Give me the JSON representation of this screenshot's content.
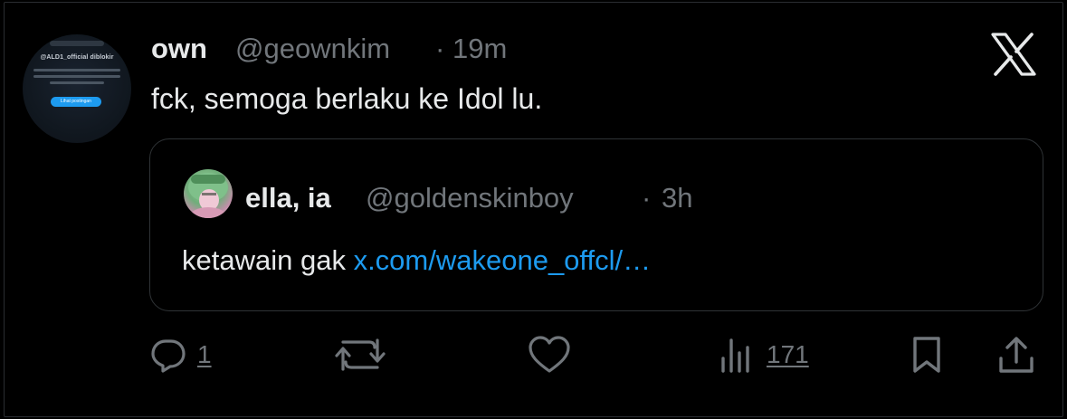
{
  "post": {
    "author_name": "own",
    "author_handle": "@geownkim",
    "separator": "·",
    "time": "19m",
    "text": "fck, semoga berlaku ke Idol lu.",
    "avatar_text": "@ALD1_official diblokir",
    "avatar_button": "Lihat postingan"
  },
  "quote": {
    "author_name": "ella, ia",
    "author_handle": "@goldenskinboy",
    "separator": "·",
    "time": "3h",
    "text": "ketawain gak ",
    "link": "x.com/wakeone_offcl/…"
  },
  "actions": {
    "replies": "1",
    "views": "171"
  },
  "icons": {
    "platform": "x-logo-icon",
    "reply": "reply-icon",
    "repost": "repost-icon",
    "like": "heart-icon",
    "views": "views-bar-chart-icon",
    "bookmark": "bookmark-icon",
    "share": "share-icon"
  },
  "colors": {
    "background": "#000000",
    "text": "#e7e9ea",
    "muted": "#71767b",
    "link": "#1d9bf0",
    "border": "#2f3336"
  }
}
